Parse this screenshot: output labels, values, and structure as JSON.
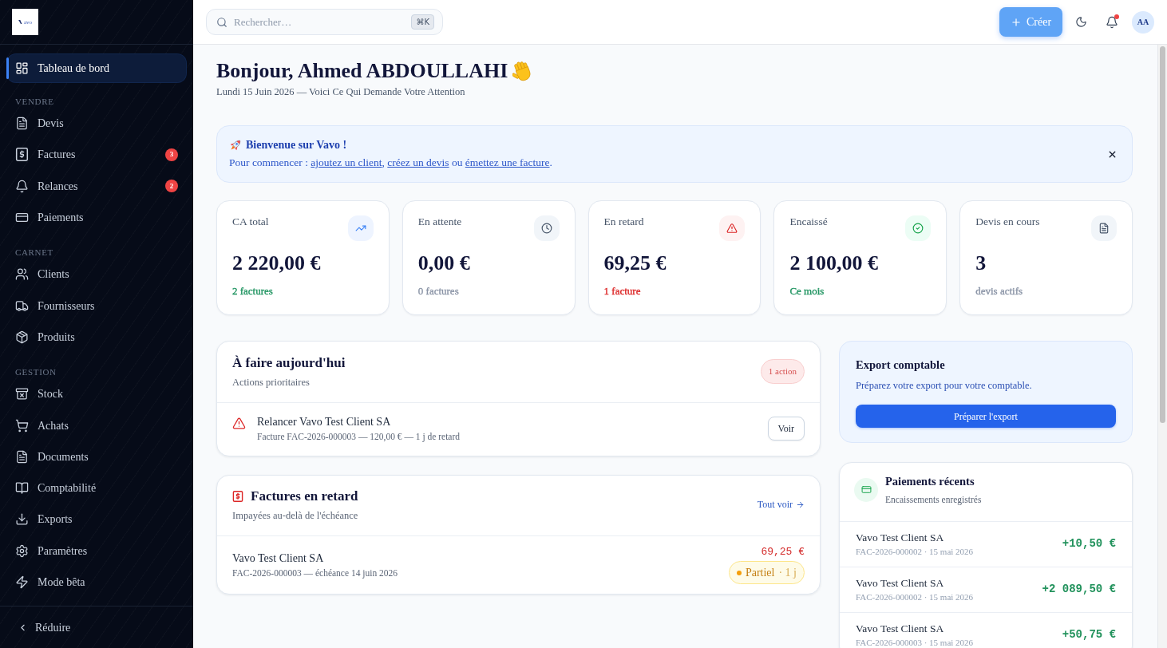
{
  "sidebar": {
    "logo_text": "avo",
    "groups": [
      {
        "items": [
          {
            "label": "Tableau de bord",
            "selected": true
          }
        ]
      },
      {
        "title": "VENDRE",
        "items": [
          {
            "label": "Devis",
            "selected": false
          },
          {
            "label": "Factures",
            "selected": false,
            "badge": "3"
          },
          {
            "label": "Relances",
            "selected": false,
            "badge": "2"
          },
          {
            "label": "Paiements",
            "selected": false
          }
        ]
      },
      {
        "title": "CARNET",
        "items": [
          {
            "label": "Clients",
            "selected": false
          },
          {
            "label": "Fournisseurs",
            "selected": false
          },
          {
            "label": "Produits",
            "selected": false
          }
        ]
      },
      {
        "title": "GESTION",
        "items": [
          {
            "label": "Stock",
            "selected": false
          },
          {
            "label": "Achats",
            "selected": false
          },
          {
            "label": "Documents",
            "selected": false
          },
          {
            "label": "Comptabilité",
            "selected": false
          },
          {
            "label": "Exports",
            "selected": false
          },
          {
            "label": "Paramètres",
            "selected": false
          },
          {
            "label": "Mode bêta",
            "selected": false
          }
        ]
      }
    ],
    "collapse_label": "Réduire"
  },
  "topbar": {
    "search": {
      "placeholder": "Rechercher…",
      "shortcut": "⌘K"
    },
    "create_button": "Créer",
    "notifications": {
      "unread": true
    },
    "avatar": "AA"
  },
  "header": {
    "greeting": "Bonjour, Ahmed ABDOULLAHI",
    "subtitle": "Lundi 15 Juin 2026 — Voici Ce Qui Demande Votre Attention"
  },
  "welcome_banner": {
    "title": "Bienvenue sur Vavo !",
    "message": [
      {
        "kind": "text",
        "text": "Pour commencer : "
      },
      {
        "kind": "link",
        "text": "ajoutez un client"
      },
      {
        "kind": "text",
        "text": ", "
      },
      {
        "kind": "link",
        "text": "créez un devis"
      },
      {
        "kind": "text",
        "text": " ou "
      },
      {
        "kind": "link",
        "text": "émettez une facture"
      },
      {
        "kind": "text",
        "text": "."
      }
    ]
  },
  "stats": [
    {
      "label": "CA total",
      "value": "2 220,00 €",
      "note": "2 factures",
      "color": "#1f9460"
    },
    {
      "label": "En attente",
      "value": "0,00 €",
      "note": "0 factures",
      "color": "#8a94a6"
    },
    {
      "label": "En retard",
      "value": "69,25 €",
      "note": "1 facture",
      "color": "#dc2626"
    },
    {
      "label": "Encaissé",
      "value": "2 100,00 €",
      "note": "Ce mois",
      "color": "#1f9460"
    },
    {
      "label": "Devis en cours",
      "value": "3",
      "note": "devis actifs",
      "color": "#8a94a6"
    }
  ],
  "todo": {
    "title": "À faire aujourd'hui",
    "subtitle": "Actions prioritaires",
    "count": "1 action",
    "tasks": [
      {
        "title": "Relancer Vavo Test Client SA",
        "detail": "Facture FAC-2026-000003 — 120,00 € — 1 j de retard",
        "action": "Voir"
      }
    ]
  },
  "overdue": {
    "title": "Factures en retard",
    "subtitle": "Impayées au-delà de l'échéance",
    "link": "Tout voir",
    "invoices": [
      {
        "client": "Vavo Test Client SA",
        "detail": "FAC-2026-000003 — échéance 14 juin 2026",
        "amount": "69,25 €",
        "status": {
          "kind": "partial",
          "label": "Partiel",
          "detail": "· 1 j"
        }
      }
    ]
  },
  "export": {
    "title": "Export comptable",
    "text": "Préparez votre export pour votre comptable.",
    "button": "Préparer l'export"
  },
  "payments": {
    "title": "Paiements récents",
    "subtitle": "Encaissements enregistrés",
    "rows": [
      {
        "client": "Vavo Test Client SA",
        "detail": "FAC-2026-000002 · 15 mai 2026",
        "amount": "+10,50 €"
      },
      {
        "client": "Vavo Test Client SA",
        "detail": "FAC-2026-000002 · 15 mai 2026",
        "amount": "+2 089,50 €"
      },
      {
        "client": "Vavo Test Client SA",
        "detail": "FAC-2026-000003 · 15 mai 2026",
        "amount": "+50,75 €"
      }
    ]
  }
}
